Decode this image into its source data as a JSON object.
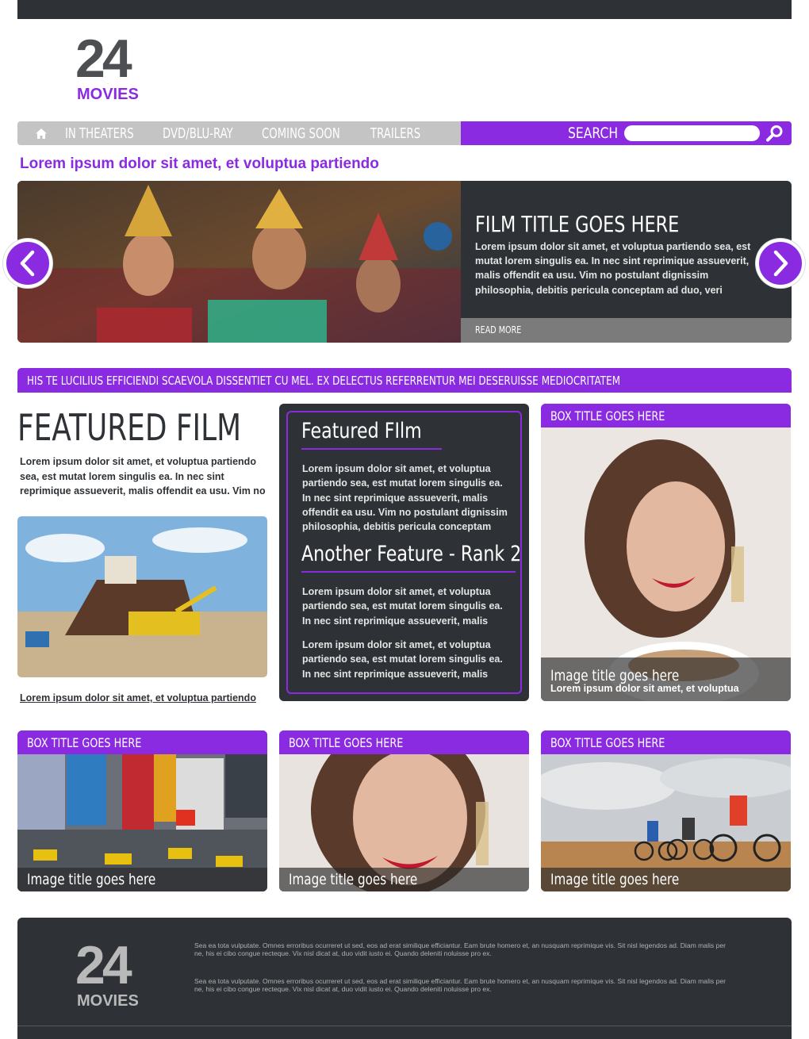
{
  "brand": {
    "number": "24",
    "word": "MOVIES"
  },
  "nav": {
    "items": [
      "IN THEATERS",
      "DVD/BLU-RAY",
      "COMING SOON",
      "TRAILERS"
    ],
    "search_label": "SEARCH",
    "search_value": ""
  },
  "tagline": "Lorem ipsum dolor sit amet, et voluptua partiendo",
  "hero": {
    "title": "FILM TITLE GOES HERE",
    "text": "Lorem ipsum dolor sit amet, et voluptua partiendo sea, est mutat lorem singulis ea. In nec sint reprimique assueverit, malis offendit ea usu. Vim no postulant dignissim philosophia, debitis pericula conceptam ad duo, veri",
    "read_more": "READ MORE"
  },
  "banner": "HIS TE LUCILIUS EFFICIENDI SCAEVOLA DISSENTIET CU MEL. EX DELECTUS REFERRENTUR MEI DESERUISSE MEDIOCRITATEM",
  "featured_film": {
    "title": "FEATURED FILM",
    "text": "Lorem ipsum dolor sit amet, et voluptua partiendo sea, est mutat lorem singulis ea. In nec sint reprimique assueverit, malis offendit ea usu. Vim no",
    "link": "Lorem ipsum dolor sit amet, et voluptua partiendo"
  },
  "feature_box": {
    "heading1": "Featured FIlm",
    "text1": "Lorem ipsum dolor sit amet, et voluptua partiendo sea, est mutat lorem singulis ea. In nec sint reprimique assueverit, malis offendit ea usu. Vim no postulant dignissim philosophia, debitis pericula conceptam",
    "heading2": "Another Feature - Rank 2",
    "text2": "Lorem ipsum dolor sit amet, et voluptua partiendo sea, est mutat lorem singulis ea. In nec sint reprimique assueverit, malis",
    "text3": "Lorem ipsum dolor sit amet, et voluptua partiendo sea, est mutat lorem singulis ea. In nec sint reprimique assueverit, malis"
  },
  "box_top": {
    "title": "BOX TITLE GOES HERE",
    "caption": "Image title goes here",
    "sub": "Lorem ipsum dolor sit amet, et voluptua"
  },
  "boxes": [
    {
      "title": "BOX TITLE GOES HERE",
      "caption": "Image title goes here"
    },
    {
      "title": "BOX TITLE GOES HERE",
      "caption": "Image title goes here"
    },
    {
      "title": "BOX TITLE GOES HERE",
      "caption": "Image title goes here"
    }
  ],
  "footer": {
    "p1": "Sea ea tota vulputate. Omnes erroribus ocurreret ut sed, eos ad erat similique efficiantur. Eam brute homero et, an nusquam reprimique vis. Sit nisl legendos ad. Diam malis per ne, his ei cibo congue recteque. Vix nisl dicat at, duo vidit iusto ei. Quando deleniti noluisse pro ex.",
    "p2": "Sea ea tota vulputate. Omnes erroribus ocurreret ut sed, eos ad erat similique efficiantur. Eam brute homero et, an nusquam reprimique vis. Sit nisl legendos ad. Diam malis per ne, his ei cibo congue recteque. Vix nisl dicat at, duo vidit iusto ei. Quando deleniti noluisse pro ex."
  },
  "colors": {
    "accent": "#8a2be2",
    "dark": "#2e3236",
    "nav_gray": "#c4c4c4"
  },
  "icons": [
    "home-icon",
    "search-icon",
    "chevron-left-icon",
    "chevron-right-icon"
  ]
}
